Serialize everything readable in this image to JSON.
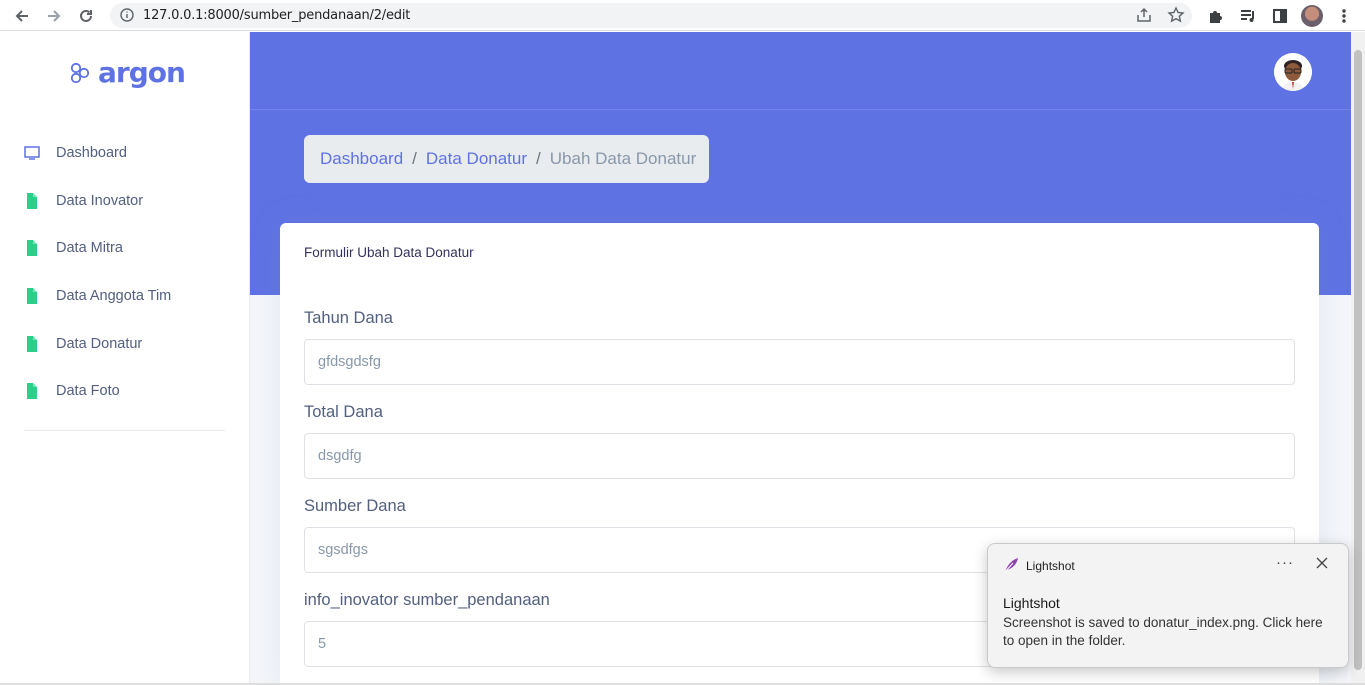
{
  "browser": {
    "url": "127.0.0.1:8000/sumber_pendanaan/2/edit",
    "icons": [
      "back-arrow-icon",
      "forward-arrow-icon",
      "reload-icon",
      "info-icon",
      "share-icon",
      "star-icon",
      "puzzle-icon",
      "media-icon",
      "sidepanel-icon",
      "kebab-menu-icon"
    ]
  },
  "brand": {
    "name": "argon",
    "color": "#5e72e4"
  },
  "sidebar": {
    "items": [
      {
        "label": "Dashboard",
        "icon": "monitor-icon"
      },
      {
        "label": "Data Inovator",
        "icon": "file-icon"
      },
      {
        "label": "Data Mitra",
        "icon": "file-icon"
      },
      {
        "label": "Data Anggota Tim",
        "icon": "file-icon"
      },
      {
        "label": "Data Donatur",
        "icon": "file-icon"
      },
      {
        "label": "Data Foto",
        "icon": "file-icon"
      }
    ]
  },
  "breadcrumb": {
    "items": [
      "Dashboard",
      "Data Donatur",
      "Ubah Data Donatur"
    ],
    "separator": "/"
  },
  "card": {
    "title": "Formulir Ubah Data Donatur",
    "fields": [
      {
        "label": "Tahun Dana",
        "value": "gfdsgdsfg"
      },
      {
        "label": "Total Dana",
        "value": "dsgdfg"
      },
      {
        "label": "Sumber Dana",
        "value": "sgsdfgs"
      },
      {
        "label": "info_inovator sumber_pendanaan",
        "value": "5"
      }
    ]
  },
  "toast": {
    "app": "Lightshot",
    "more": "···",
    "title": "Lightshot",
    "body": "Screenshot is saved to donatur_index.png. Click here to open in the folder."
  }
}
